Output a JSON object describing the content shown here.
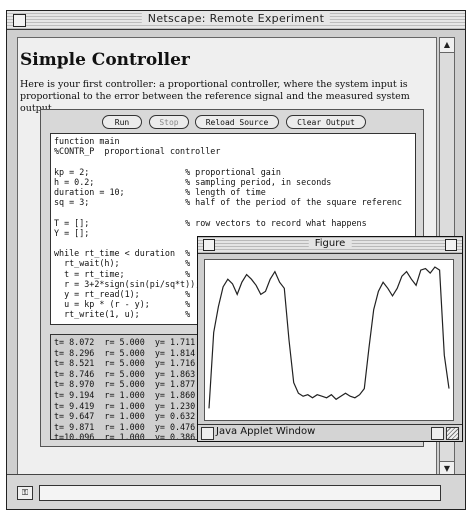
{
  "window": {
    "title": "Netscape: Remote Experiment"
  },
  "page": {
    "heading": "Simple Controller",
    "intro": "Here is your first controller: a proportional controller, where the system input is proportional to the error between the reference signal and the measured system output."
  },
  "toolbar": {
    "run_label": "Run",
    "stop_label": "Stop",
    "reload_label": "Reload Source",
    "clear_label": "Clear Output"
  },
  "code": {
    "lines": [
      "function main",
      "%CONTR_P  proportional controller",
      "",
      "kp = 2;                   % proportional gain",
      "h = 0.2;                  % sampling period, in seconds",
      "duration = 10;            % length of time",
      "sq = 3;                   % half of the period of the square referenc",
      "",
      "T = [];                   % row vectors to record what happens",
      "Y = [];",
      "",
      "while rt_time < duration  %",
      "  rt_wait(h);             %",
      "  t = rt_time;            %",
      "  r = 3+2*sign(sin(pi/sq*t));",
      "  y = rt_read(1);         %",
      "  u = kp * (r - y);       %",
      "  rt_write(1, u);         %"
    ]
  },
  "output": {
    "lines": [
      "t= 8.072  r= 5.000  y= 1.711",
      "t= 8.296  r= 5.000  y= 1.814",
      "t= 8.521  r= 5.000  y= 1.716",
      "t= 8.746  r= 5.000  y= 1.863",
      "t= 8.970  r= 5.000  y= 1.877",
      "t= 9.194  r= 1.000  y= 1.860",
      "t= 9.419  r= 1.000  y= 1.230",
      "t= 9.647  r= 1.000  y= 0.632",
      "t= 9.871  r= 1.000  y= 0.476",
      "t=10.096  r= 1.000  y= 0.386"
    ]
  },
  "figure": {
    "title": "Figure",
    "status_label": "Java Applet Window",
    "line_color": "#222222",
    "plot_values": [
      0.05,
      0.55,
      0.72,
      0.85,
      0.9,
      0.87,
      0.8,
      0.88,
      0.93,
      0.9,
      0.86,
      0.8,
      0.82,
      0.9,
      0.95,
      0.88,
      0.84,
      0.5,
      0.22,
      0.15,
      0.13,
      0.14,
      0.12,
      0.14,
      0.13,
      0.12,
      0.14,
      0.11,
      0.13,
      0.15,
      0.13,
      0.12,
      0.14,
      0.18,
      0.45,
      0.7,
      0.82,
      0.88,
      0.84,
      0.79,
      0.84,
      0.92,
      0.95,
      0.9,
      0.86,
      0.96,
      0.97,
      0.94,
      0.98,
      0.96,
      0.4,
      0.18
    ]
  }
}
